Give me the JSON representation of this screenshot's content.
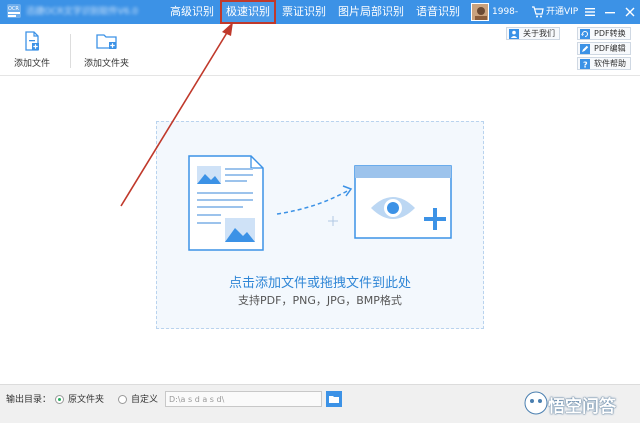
{
  "titlebar": {
    "app_title": "迅捷OCR文字识别软件V6.0",
    "nav": [
      "高级识别",
      "极速识别",
      "票证识别",
      "图片局部识别",
      "语音识别"
    ],
    "active_nav": "极速识别",
    "user_name": "1998-",
    "vip_label": "开通VIP"
  },
  "toolbar": {
    "add_file": "添加文件",
    "add_folder": "添加文件夹",
    "about": "关于我们",
    "pdf_convert": "PDF转换",
    "pdf_edit": "PDF编辑",
    "help": "软件帮助"
  },
  "dropzone": {
    "title": "点击添加文件或拖拽文件到此处",
    "subtitle": "支持PDF，PNG，JPG，BMP格式"
  },
  "bottom": {
    "output_label": "输出目录：",
    "opt_original": "原文件夹",
    "opt_custom": "自定义",
    "path_value": "D:\\a s d a s d\\"
  },
  "watermark": "悟空问答",
  "colors": {
    "primary": "#3c92e6",
    "accent": "#2f86d6",
    "annotation": "#c0392b"
  }
}
